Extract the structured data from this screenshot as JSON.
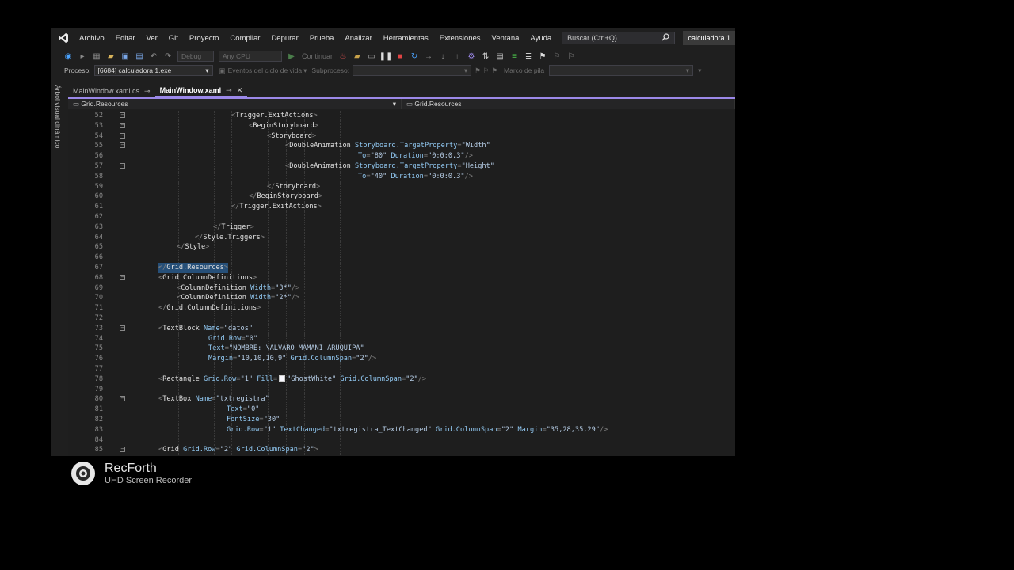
{
  "menu": [
    "Archivo",
    "Editar",
    "Ver",
    "Git",
    "Proyecto",
    "Compilar",
    "Depurar",
    "Prueba",
    "Analizar",
    "Herramientas",
    "Extensiones",
    "Ventana",
    "Ayuda"
  ],
  "search": {
    "placeholder": "Buscar (Ctrl+Q)"
  },
  "solution": "calculadora 1",
  "toolbar": {
    "config": "Debug",
    "platform": "Any CPU",
    "continue": "Continuar"
  },
  "debugbar": {
    "process_label": "Proceso:",
    "process_value": "[6684] calculadora 1.exe",
    "lifecycle": "Eventos del ciclo de vida",
    "thread_label": "Subproceso:",
    "stack_label": "Marco de pila"
  },
  "side_panel": "Árbol visual dinámico",
  "tabs": [
    {
      "label": "MainWindow.xaml.cs",
      "active": false
    },
    {
      "label": "MainWindow.xaml",
      "active": true
    }
  ],
  "nav": {
    "left": "Grid.Resources",
    "right": "Grid.Resources"
  },
  "colors": {
    "accent": "#9b88e8",
    "tag": "#e0e0e0",
    "attr": "#92caf4",
    "string": "#ce9178"
  },
  "code": [
    {
      "n": "52",
      "fold": true,
      "segs": [
        [
          "p",
          "<"
        ],
        [
          "t",
          "Trigger.ExitActions"
        ],
        [
          "p",
          ">"
        ]
      ]
    },
    {
      "n": "53",
      "fold": true,
      "segs": [
        [
          "p",
          "<"
        ],
        [
          "t",
          "BeginStoryboard"
        ],
        [
          "p",
          ">"
        ]
      ]
    },
    {
      "n": "54",
      "fold": true,
      "segs": [
        [
          "p",
          "<"
        ],
        [
          "t",
          "Storyboard"
        ],
        [
          "p",
          ">"
        ]
      ]
    },
    {
      "n": "55",
      "fold": true,
      "segs": [
        [
          "p",
          "<"
        ],
        [
          "t",
          "DoubleAnimation "
        ],
        [
          "a",
          "Storyboard.TargetProperty"
        ],
        [
          "p",
          "="
        ],
        [
          "sv",
          "\"Width\""
        ]
      ]
    },
    {
      "n": "56",
      "fold": false,
      "segs": [
        [
          "a",
          "To"
        ],
        [
          "p",
          "="
        ],
        [
          "sv",
          "\"80\" "
        ],
        [
          "a",
          "Duration"
        ],
        [
          "p",
          "="
        ],
        [
          "sv",
          "\"0:0:0.3\""
        ],
        [
          "p",
          "/>"
        ]
      ]
    },
    {
      "n": "57",
      "fold": true,
      "segs": [
        [
          "p",
          "<"
        ],
        [
          "t",
          "DoubleAnimation "
        ],
        [
          "a",
          "Storyboard.TargetProperty"
        ],
        [
          "p",
          "="
        ],
        [
          "sv",
          "\"Height\""
        ]
      ]
    },
    {
      "n": "58",
      "fold": false,
      "segs": [
        [
          "a",
          "To"
        ],
        [
          "p",
          "="
        ],
        [
          "sv",
          "\"40\" "
        ],
        [
          "a",
          "Duration"
        ],
        [
          "p",
          "="
        ],
        [
          "sv",
          "\"0:0:0.3\""
        ],
        [
          "p",
          "/>"
        ]
      ]
    },
    {
      "n": "59",
      "fold": false,
      "segs": [
        [
          "p",
          "</"
        ],
        [
          "t",
          "Storyboard"
        ],
        [
          "p",
          ">"
        ]
      ]
    },
    {
      "n": "60",
      "fold": false,
      "segs": [
        [
          "p",
          "</"
        ],
        [
          "t",
          "BeginStoryboard"
        ],
        [
          "p",
          ">"
        ]
      ]
    },
    {
      "n": "61",
      "fold": false,
      "segs": [
        [
          "p",
          "</"
        ],
        [
          "t",
          "Trigger.ExitActions"
        ],
        [
          "p",
          ">"
        ]
      ]
    },
    {
      "n": "62",
      "fold": false,
      "segs": []
    },
    {
      "n": "63",
      "fold": false,
      "segs": [
        [
          "p",
          "</"
        ],
        [
          "t",
          "Trigger"
        ],
        [
          "p",
          ">"
        ]
      ]
    },
    {
      "n": "64",
      "fold": false,
      "segs": [
        [
          "p",
          "</"
        ],
        [
          "t",
          "Style.Triggers"
        ],
        [
          "p",
          ">"
        ]
      ]
    },
    {
      "n": "65",
      "fold": false,
      "segs": [
        [
          "p",
          "</"
        ],
        [
          "t",
          "Style"
        ],
        [
          "p",
          ">"
        ]
      ]
    },
    {
      "n": "66",
      "fold": false,
      "segs": []
    },
    {
      "n": "67",
      "fold": false,
      "sel": true,
      "segs": [
        [
          "p",
          "</"
        ],
        [
          "t",
          "Grid.Resources"
        ],
        [
          "p",
          ">"
        ]
      ]
    },
    {
      "n": "68",
      "fold": true,
      "segs": [
        [
          "p",
          "<"
        ],
        [
          "t",
          "Grid.ColumnDefinitions"
        ],
        [
          "p",
          ">"
        ]
      ]
    },
    {
      "n": "69",
      "fold": false,
      "segs": [
        [
          "p",
          "<"
        ],
        [
          "t",
          "ColumnDefinition "
        ],
        [
          "a",
          "Width"
        ],
        [
          "p",
          "="
        ],
        [
          "sv",
          "\"3*\""
        ],
        [
          "p",
          "/>"
        ]
      ]
    },
    {
      "n": "70",
      "fold": false,
      "segs": [
        [
          "p",
          "<"
        ],
        [
          "t",
          "ColumnDefinition "
        ],
        [
          "a",
          "Width"
        ],
        [
          "p",
          "="
        ],
        [
          "sv",
          "\"2*\""
        ],
        [
          "p",
          "/>"
        ]
      ]
    },
    {
      "n": "71",
      "fold": false,
      "segs": [
        [
          "p",
          "</"
        ],
        [
          "t",
          "Grid.ColumnDefinitions"
        ],
        [
          "p",
          ">"
        ]
      ]
    },
    {
      "n": "72",
      "fold": false,
      "segs": []
    },
    {
      "n": "73",
      "fold": true,
      "segs": [
        [
          "p",
          "<"
        ],
        [
          "t",
          "TextBlock "
        ],
        [
          "a",
          "Name"
        ],
        [
          "p",
          "="
        ],
        [
          "sv",
          "\"datos\""
        ]
      ]
    },
    {
      "n": "74",
      "fold": false,
      "segs": [
        [
          "a",
          "Grid.Row"
        ],
        [
          "p",
          "="
        ],
        [
          "sv",
          "\"0\""
        ]
      ]
    },
    {
      "n": "75",
      "fold": false,
      "segs": [
        [
          "a",
          "Text"
        ],
        [
          "p",
          "="
        ],
        [
          "sv",
          "\"NOMBRE: \\ALVARO MAMANI ARUQUIPA\""
        ]
      ]
    },
    {
      "n": "76",
      "fold": false,
      "segs": [
        [
          "a",
          "Margin"
        ],
        [
          "p",
          "="
        ],
        [
          "sv",
          "\"10,10,10,9\" "
        ],
        [
          "a",
          "Grid.ColumnSpan"
        ],
        [
          "p",
          "="
        ],
        [
          "sv",
          "\"2\""
        ],
        [
          "p",
          "/>"
        ]
      ]
    },
    {
      "n": "77",
      "fold": false,
      "segs": []
    },
    {
      "n": "78",
      "fold": false,
      "segs": [
        [
          "p",
          "<"
        ],
        [
          "t",
          "Rectangle "
        ],
        [
          "a",
          "Grid.Row"
        ],
        [
          "p",
          "="
        ],
        [
          "sv",
          "\"1\" "
        ],
        [
          "a",
          "Fill"
        ],
        [
          "p",
          "="
        ],
        [
          "swatch",
          ""
        ],
        [
          "sv",
          "\"GhostWhite\" "
        ],
        [
          "a",
          "Grid.ColumnSpan"
        ],
        [
          "p",
          "="
        ],
        [
          "sv",
          "\"2\""
        ],
        [
          "p",
          "/>"
        ]
      ]
    },
    {
      "n": "79",
      "fold": false,
      "segs": []
    },
    {
      "n": "80",
      "fold": true,
      "segs": [
        [
          "p",
          "<"
        ],
        [
          "t",
          "TextBox "
        ],
        [
          "a",
          "Name"
        ],
        [
          "p",
          "="
        ],
        [
          "sv",
          "\"txtregistra\""
        ]
      ]
    },
    {
      "n": "81",
      "fold": false,
      "segs": [
        [
          "a",
          "Text"
        ],
        [
          "p",
          "="
        ],
        [
          "sv",
          "\"0\""
        ]
      ]
    },
    {
      "n": "82",
      "fold": false,
      "segs": [
        [
          "a",
          "FontSize"
        ],
        [
          "p",
          "="
        ],
        [
          "sv",
          "\"30\""
        ]
      ]
    },
    {
      "n": "83",
      "fold": false,
      "segs": [
        [
          "a",
          "Grid.Row"
        ],
        [
          "p",
          "="
        ],
        [
          "sv",
          "\"1\" "
        ],
        [
          "a",
          "TextChanged"
        ],
        [
          "p",
          "="
        ],
        [
          "sv",
          "\"txtregistra_TextChanged\" "
        ],
        [
          "a",
          "Grid.ColumnSpan"
        ],
        [
          "p",
          "="
        ],
        [
          "sv",
          "\"2\" "
        ],
        [
          "a",
          "Margin"
        ],
        [
          "p",
          "="
        ],
        [
          "sv",
          "\"35,28,35,29\""
        ],
        [
          "p",
          "/>"
        ]
      ]
    },
    {
      "n": "84",
      "fold": false,
      "segs": []
    },
    {
      "n": "85",
      "fold": true,
      "segs": [
        [
          "p",
          "<"
        ],
        [
          "t",
          "Grid "
        ],
        [
          "a",
          "Grid.Row"
        ],
        [
          "p",
          "="
        ],
        [
          "sv",
          "\"2\" "
        ],
        [
          "a",
          "Grid.ColumnSpan"
        ],
        [
          "p",
          "="
        ],
        [
          "sv",
          "\"2\""
        ],
        [
          "p",
          ">"
        ]
      ]
    }
  ],
  "watermark": {
    "name": "RecForth",
    "sub": "UHD Screen Recorder"
  }
}
